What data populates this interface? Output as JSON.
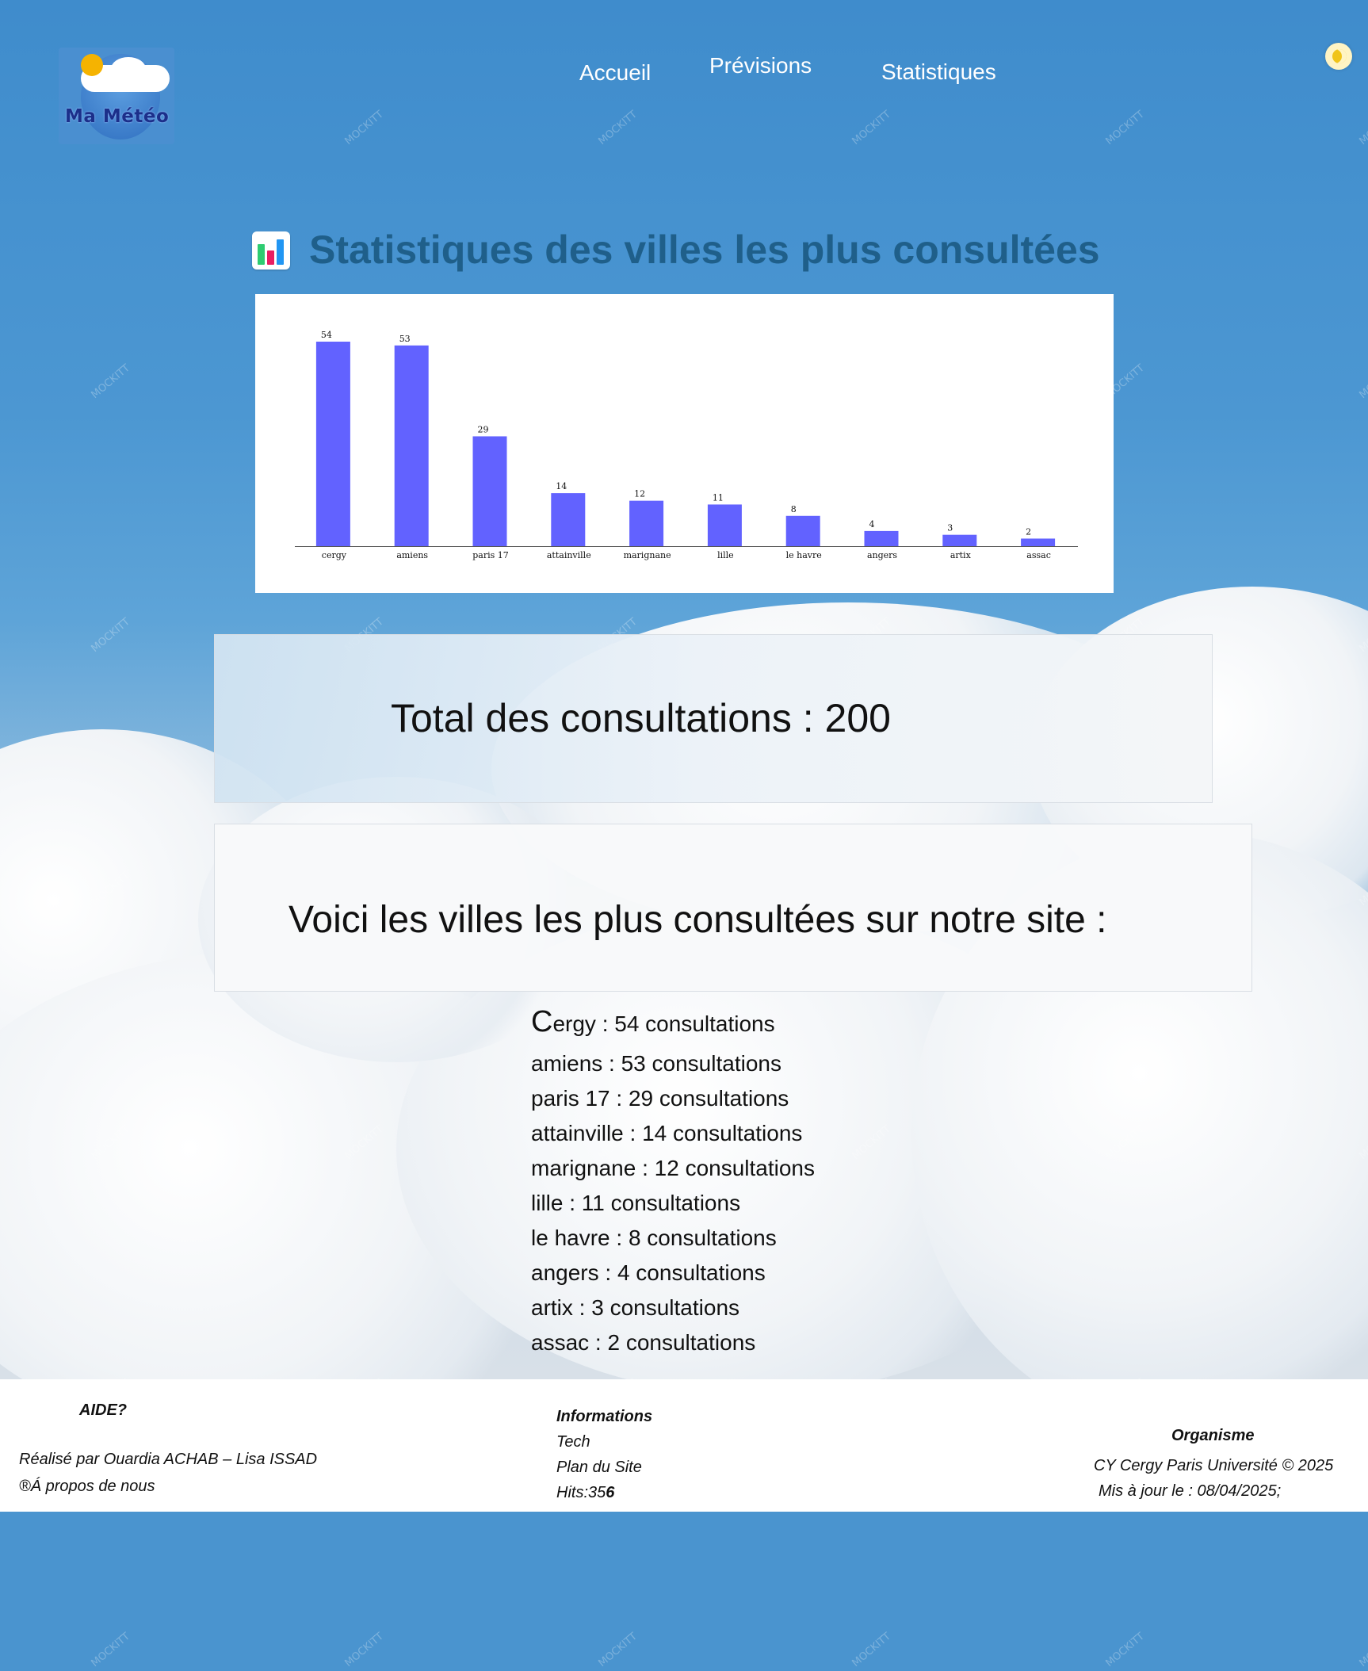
{
  "header": {
    "brand": "Ma Météo",
    "nav": [
      {
        "label": "Accueil"
      },
      {
        "label": "Prévisions"
      },
      {
        "label": "Statistiques"
      }
    ]
  },
  "main": {
    "title": "Statistiques des villes les plus consultées",
    "total_text": "Total des consultations : 200",
    "villes_heading": "Voici les villes les plus consultées sur notre site :",
    "cities": [
      {
        "text": "Cergy : 54 consultations"
      },
      {
        "text": "amiens : 53 consultations"
      },
      {
        "text": "paris 17 : 29 consultations"
      },
      {
        "text": "attainville : 14 consultations"
      },
      {
        "text": "marignane : 12 consultations"
      },
      {
        "text": "lille : 11 consultations"
      },
      {
        "text": "le havre : 8 consultations"
      },
      {
        "text": "angers : 4 consultations"
      },
      {
        "text": "artix : 3 consultations"
      },
      {
        "text": "assac : 2 consultations"
      }
    ],
    "first_city_initial": "C",
    "first_city_rest": "ergy : 54 consultations"
  },
  "chart_data": {
    "type": "bar",
    "categories": [
      "cergy",
      "amiens",
      "paris 17",
      "attainville",
      "marignane",
      "lille",
      "le havre",
      "angers",
      "artix",
      "assac"
    ],
    "values": [
      54,
      53,
      29,
      14,
      12,
      11,
      8,
      4,
      3,
      2
    ],
    "title": "",
    "xlabel": "",
    "ylabel": "",
    "ylim": [
      0,
      54
    ],
    "bar_color": "#6262ff",
    "data_labels": true,
    "grid": false
  },
  "footer": {
    "aide": "AIDE?",
    "credits": "Réalisé par Ouardia ACHAB – Lisa ISSAD",
    "about": "®Á propos de nous",
    "info_title": "Informations",
    "info_tech": "Tech",
    "info_plan": "Plan du Site",
    "hits_label": "Hits:35",
    "hits_last": "6",
    "org_title": "Organisme",
    "org_name": "CY Cergy Paris Université © 2025",
    "updated": "Mis à jour le : 08/04/2025;"
  },
  "watermark": "MOCKITT",
  "colors": {
    "accent": "#1f5f8a",
    "bar": "#6262ff",
    "sky": "#4a94cf"
  }
}
